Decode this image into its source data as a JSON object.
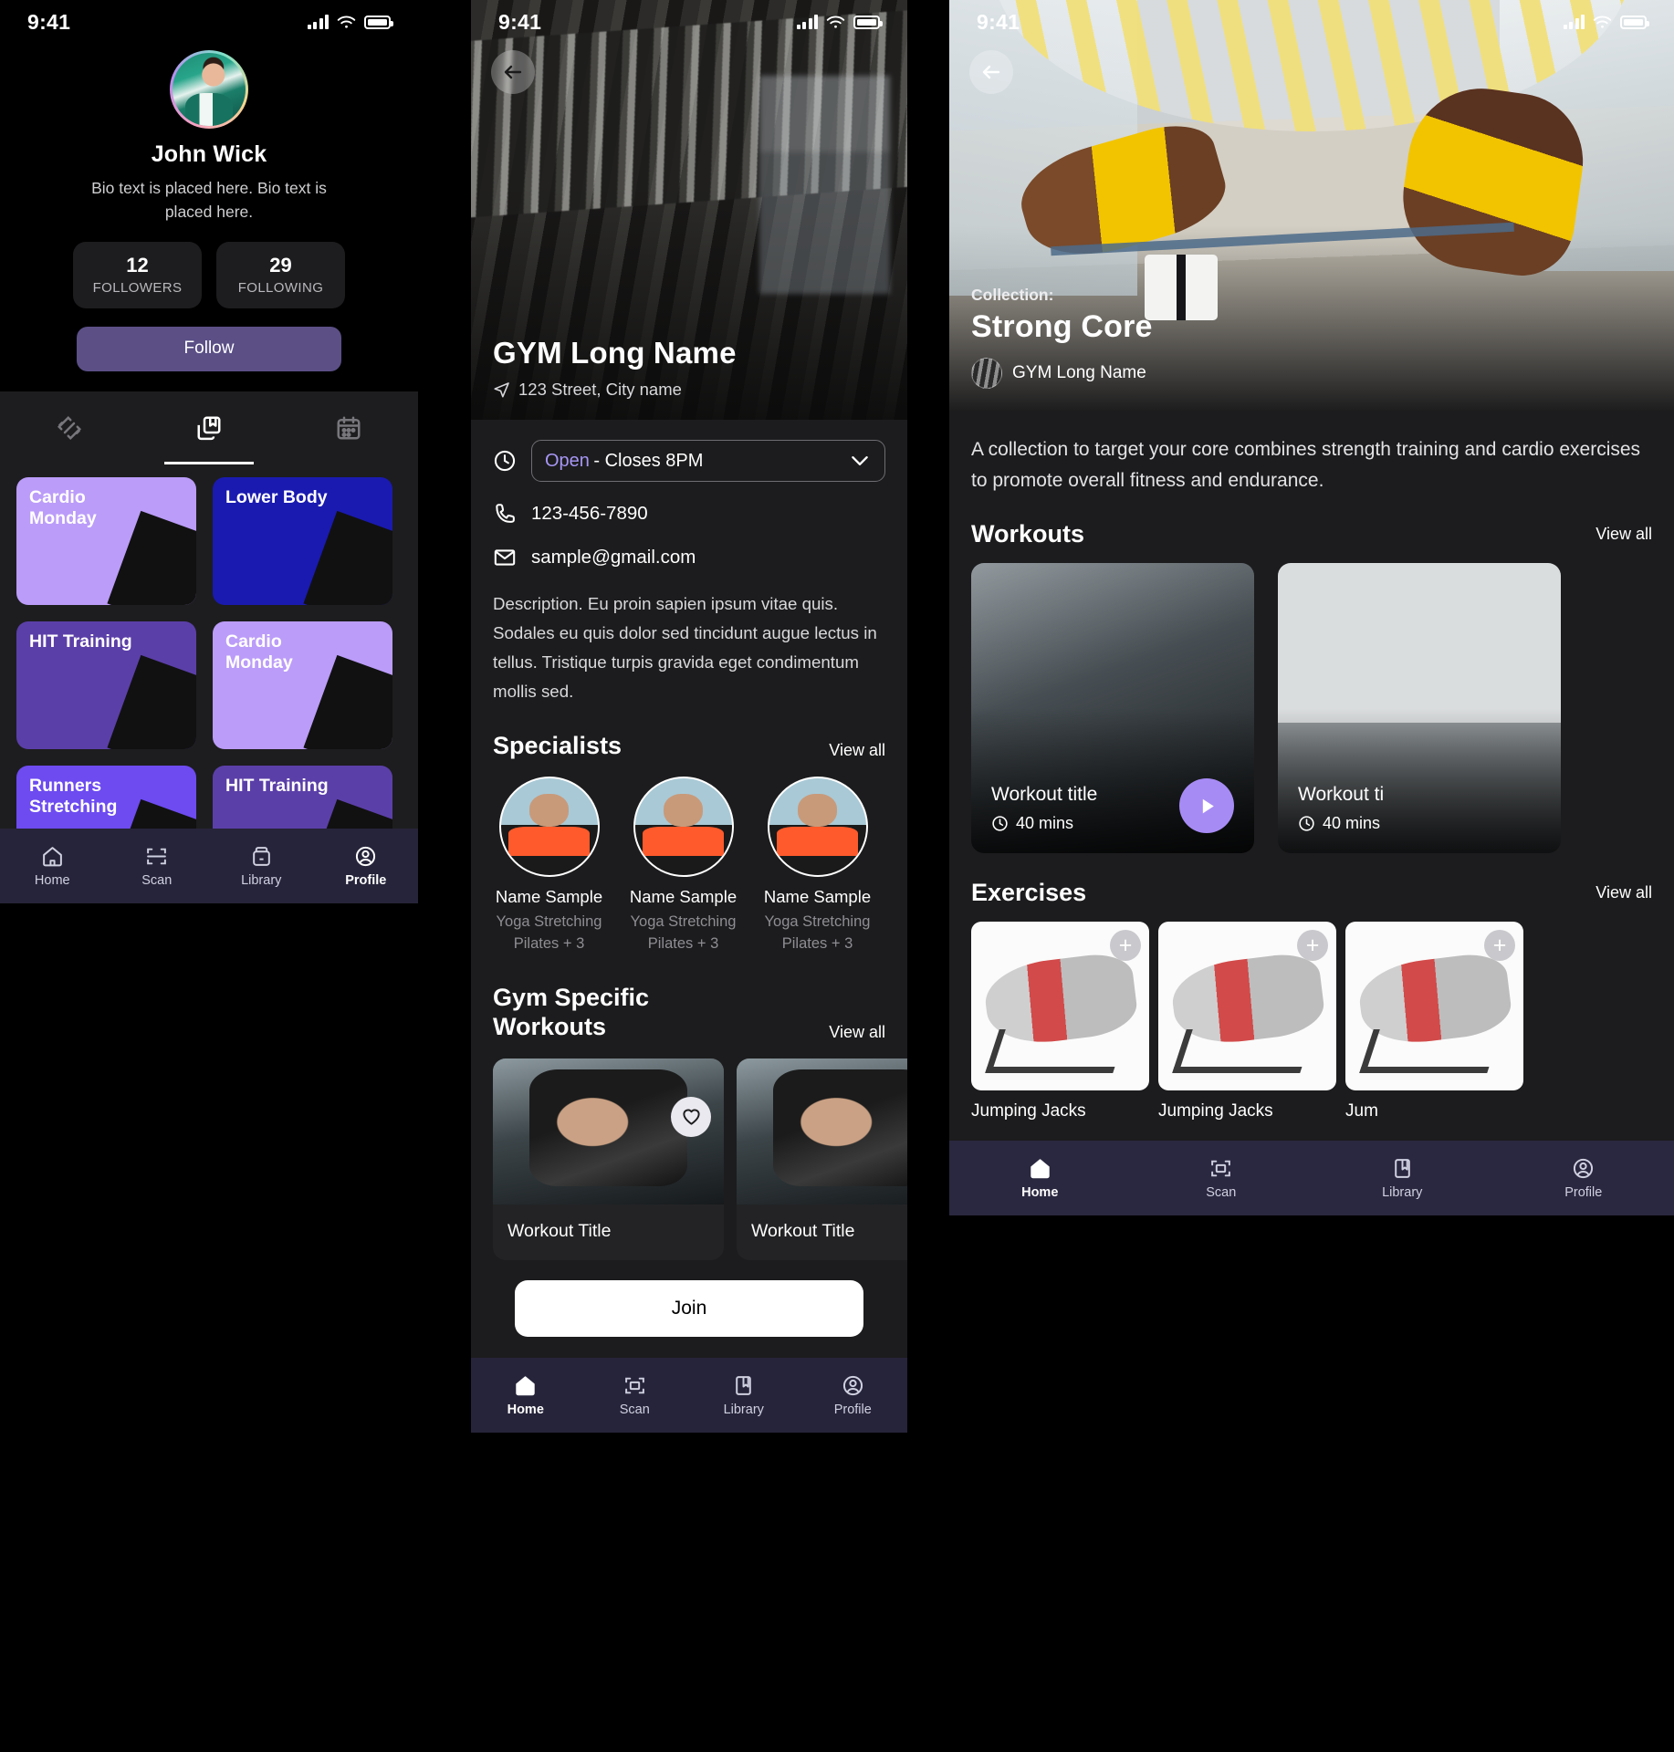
{
  "statusbar": {
    "time": "9:41"
  },
  "profile": {
    "name": "John Wick",
    "bio": "Bio text is  placed here. Bio text is placed here.",
    "stats": [
      {
        "num": "12",
        "label": "FOLLOWERS"
      },
      {
        "num": "29",
        "label": "FOLLOWING"
      }
    ],
    "follow_label": "Follow",
    "tabs": [
      {
        "icon": "dumbbell-icon",
        "active": false
      },
      {
        "icon": "saved-collections-icon",
        "active": true
      },
      {
        "icon": "calendar-icon",
        "active": false
      }
    ],
    "cards": [
      {
        "title": "Cardio Monday",
        "color": "c-lav",
        "photo": "ph-a"
      },
      {
        "title": "Lower Body",
        "color": "c-navy",
        "photo": "ph-b"
      },
      {
        "title": "HIT Training",
        "color": "c-pur",
        "photo": "ph-c"
      },
      {
        "title": "Cardio Monday",
        "color": "c-lav",
        "photo": "ph-a"
      },
      {
        "title": "Runners Stretching",
        "color": "c-ind",
        "photo": "ph-d"
      },
      {
        "title": "HIT Training",
        "color": "c-pur",
        "photo": "ph-c"
      }
    ]
  },
  "gym": {
    "title": "GYM Long Name",
    "address": "123 Street, City name",
    "hours_open": "Open",
    "hours_rest": "- Closes 8PM",
    "phone": "123-456-7890",
    "email": "sample@gmail.com",
    "description": "Description. Eu proin sapien ipsum vitae quis. Sodales eu quis dolor sed tincidunt augue lectus in tellus. Tristique turpis gravida eget condimentum mollis sed.",
    "specialists_heading": "Specialists",
    "specialists_viewall": "View all",
    "specialists": [
      {
        "name": "Name Sample",
        "tags": "Yoga  Stretching Pilates + 3"
      },
      {
        "name": "Name Sample",
        "tags": "Yoga  Stretching Pilates + 3"
      },
      {
        "name": "Name Sample",
        "tags": "Yoga  Stretching Pilates + 3"
      }
    ],
    "workouts_heading": "Gym Specific Workouts",
    "workouts_viewall": "View all",
    "workouts": [
      {
        "title": "Workout Title"
      },
      {
        "title": "Workout Title"
      }
    ],
    "join_label": "Join"
  },
  "collection": {
    "kicker": "Collection:",
    "title": "Strong Core",
    "gym_name": "GYM Long Name",
    "description": "A collection to target your core combines strength training and cardio exercises to promote overall fitness and endurance.",
    "workouts_heading": "Workouts",
    "workouts_viewall": "View all",
    "workouts": [
      {
        "title": "Workout title",
        "duration": "40 mins"
      },
      {
        "title": "Workout ti",
        "duration": "40 mins"
      }
    ],
    "exercises_heading": "Exercises",
    "exercises_viewall": "View all",
    "exercises": [
      {
        "name": "Jumping Jacks"
      },
      {
        "name": "Jumping Jacks"
      },
      {
        "name": "Jum"
      }
    ]
  },
  "tabbar": {
    "items": [
      {
        "label": "Home",
        "icon": "home-icon",
        "active": true
      },
      {
        "label": "Scan",
        "icon": "scan-icon",
        "active": false
      },
      {
        "label": "Library",
        "icon": "library-icon",
        "active": false
      },
      {
        "label": "Profile",
        "icon": "profile-icon",
        "active": false
      }
    ],
    "profile_panel_active": "Profile"
  },
  "colors": {
    "accent_purple": "#a796f5",
    "follow_bg": "#5b4f86",
    "play_button": "#a78bf5",
    "tabbar_bg": "#26243a"
  }
}
